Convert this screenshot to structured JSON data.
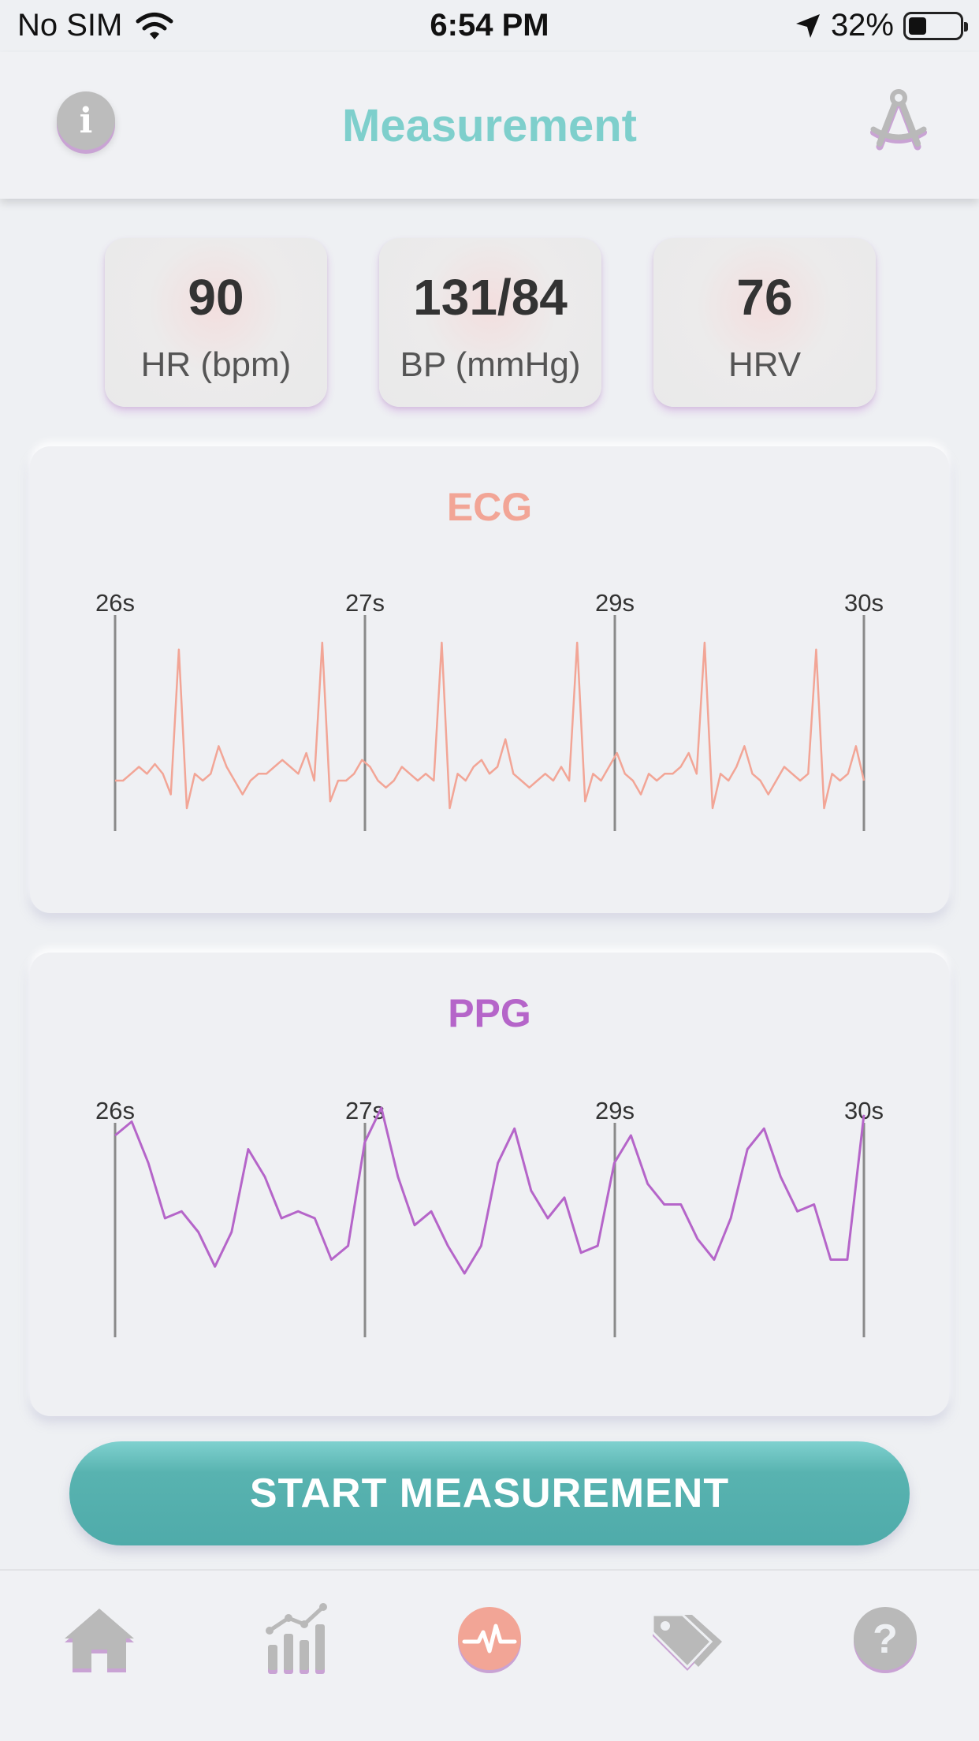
{
  "status_bar": {
    "carrier": "No SIM",
    "time": "6:54 PM",
    "battery": "32%"
  },
  "header": {
    "title": "Measurement",
    "info_icon": "info-icon",
    "right_icon": "compass-icon"
  },
  "metrics": [
    {
      "value": "90",
      "label": "HR (bpm)"
    },
    {
      "value": "131/84",
      "label": "BP (mmHg)"
    },
    {
      "value": "76",
      "label": "HRV"
    }
  ],
  "ecg": {
    "title": "ECG",
    "color": "#f2a596"
  },
  "ppg": {
    "title": "PPG",
    "color": "#b565c9"
  },
  "chart_data": [
    {
      "type": "line",
      "title": "ECG",
      "x_ticks": [
        "26s",
        "27s",
        "29s",
        "30s"
      ],
      "series": [
        {
          "values": [
            0.0,
            0.0,
            0.05,
            0.1,
            0.05,
            0.12,
            0.05,
            -0.1,
            0.95,
            -0.2,
            0.05,
            0.0,
            0.05,
            0.25,
            0.1,
            0.0,
            -0.1,
            0.0,
            0.05,
            0.05,
            0.1,
            0.15,
            0.1,
            0.05,
            0.2,
            0.0,
            1.0,
            -0.15,
            0.0,
            0.0,
            0.05,
            0.15,
            0.1,
            0.0,
            -0.05,
            0.0,
            0.1,
            0.05,
            0.0,
            0.05,
            0.0,
            1.0,
            -0.2,
            0.05,
            0.0,
            0.1,
            0.15,
            0.05,
            0.1,
            0.3,
            0.05,
            0.0,
            -0.05,
            0.0,
            0.05,
            0.0,
            0.1,
            0.0,
            1.0,
            -0.15,
            0.05,
            0.0,
            0.1,
            0.2,
            0.05,
            0.0,
            -0.1,
            0.05,
            0.0,
            0.05,
            0.05,
            0.1,
            0.2,
            0.05,
            1.0,
            -0.2,
            0.05,
            0.0,
            0.1,
            0.25,
            0.05,
            0.0,
            -0.1,
            0.0,
            0.1,
            0.05,
            0.0,
            0.05,
            0.95,
            -0.2,
            0.05,
            0.0,
            0.05,
            0.25,
            0.0
          ]
        }
      ]
    },
    {
      "type": "line",
      "title": "PPG",
      "x_ticks": [
        "26s",
        "27s",
        "29s",
        "30s"
      ],
      "series": [
        {
          "values": [
            0.8,
            0.9,
            0.6,
            0.2,
            0.25,
            0.1,
            -0.15,
            0.1,
            0.7,
            0.5,
            0.2,
            0.25,
            0.2,
            -0.1,
            0.0,
            0.75,
            1.0,
            0.5,
            0.15,
            0.25,
            0.0,
            -0.2,
            0.0,
            0.6,
            0.85,
            0.4,
            0.2,
            0.35,
            -0.05,
            0.0,
            0.6,
            0.8,
            0.45,
            0.3,
            0.3,
            0.05,
            -0.1,
            0.2,
            0.7,
            0.85,
            0.5,
            0.25,
            0.3,
            -0.1,
            -0.1,
            0.95
          ]
        }
      ]
    }
  ],
  "start_button": {
    "label": "START MEASUREMENT"
  },
  "nav": [
    {
      "icon": "home-icon"
    },
    {
      "icon": "chart-icon"
    },
    {
      "icon": "heartbeat-icon",
      "active": true
    },
    {
      "icon": "tags-icon"
    },
    {
      "icon": "help-icon"
    }
  ]
}
